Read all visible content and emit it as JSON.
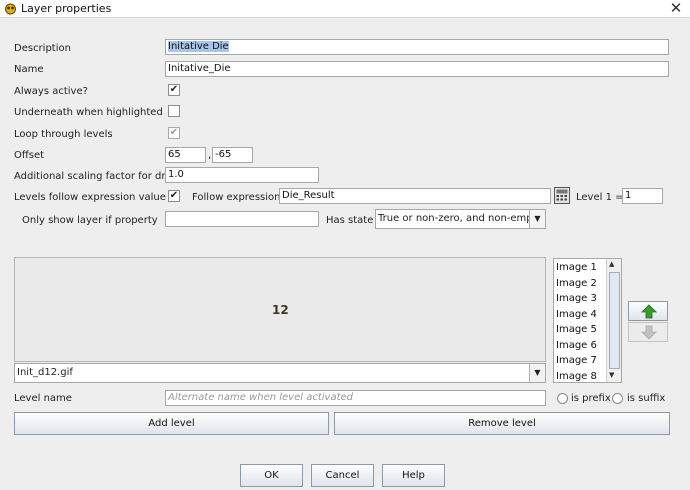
{
  "window": {
    "title": "Layer properties",
    "close": "✕"
  },
  "form": {
    "description_label": "Description",
    "description_value": "Initative Die",
    "name_label": "Name",
    "name_value": "Initative_Die",
    "always_active_label": "Always active?",
    "always_active_checked": "✔",
    "underneath_label": "Underneath when highlighted",
    "underneath_checked": "",
    "loop_label": "Loop through levels",
    "loop_checked": "✔",
    "offset_label": "Offset",
    "offset_x": "65",
    "offset_comma": ",",
    "offset_y": "-65",
    "scale_label": "Additional scaling factor for draw",
    "scale_value": "1.0",
    "levels_follow_label": "Levels follow expression value",
    "levels_follow_checked": "✔",
    "follow_expr_label": "Follow expression",
    "follow_expr_value": "Die_Result",
    "level1_label": "Level 1 =",
    "level1_value": "1",
    "only_show_label": "Only show layer if property",
    "only_show_value": "",
    "has_state_label": "Has state",
    "has_state_value": "True or non-zero, and non-empty"
  },
  "preview": {
    "text": "12"
  },
  "image_select": {
    "value": "Init_d12.gif"
  },
  "image_list": [
    "Image 1",
    "Image 2",
    "Image 3",
    "Image 4",
    "Image 5",
    "Image 6",
    "Image 7",
    "Image 8"
  ],
  "level_name": {
    "label": "Level name",
    "placeholder": "Alternate name when level activated",
    "is_prefix": "is prefix",
    "is_suffix": "is suffix"
  },
  "buttons": {
    "add_level": "Add level",
    "remove_level": "Remove level",
    "ok": "OK",
    "cancel": "Cancel",
    "help": "Help"
  },
  "icons": {
    "title_icon": "vassal-icon",
    "calculator": "calculator-icon",
    "move_up": "arrow-up-icon",
    "move_down": "arrow-down-icon"
  },
  "colors": {
    "up_arrow": "#3a9a2f",
    "selection": "#a8c5e8"
  }
}
